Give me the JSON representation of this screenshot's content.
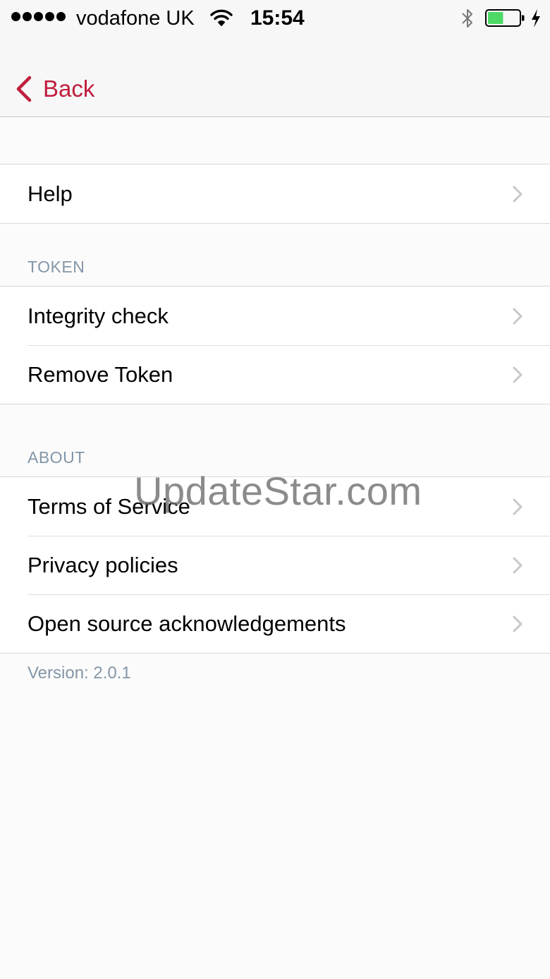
{
  "status_bar": {
    "carrier": "vodafone UK",
    "time": "15:54",
    "signal_icon": "signal-dots-icon",
    "wifi_icon": "wifi-icon",
    "bluetooth_icon": "bluetooth-icon",
    "battery_icon": "battery-charging-icon",
    "battery_level": 0.5,
    "battery_color": "#4cd964"
  },
  "nav": {
    "back_label": "Back",
    "accent_color": "#c01d3d"
  },
  "sections": {
    "general": {
      "items": [
        {
          "label": "Help"
        }
      ]
    },
    "token": {
      "header": "TOKEN",
      "items": [
        {
          "label": "Integrity check"
        },
        {
          "label": "Remove Token"
        }
      ]
    },
    "about": {
      "header": "ABOUT",
      "items": [
        {
          "label": "Terms of Service"
        },
        {
          "label": "Privacy policies"
        },
        {
          "label": "Open source acknowledgements"
        }
      ]
    }
  },
  "footer": {
    "version": "Version: 2.0.1"
  },
  "watermark": "UpdateStar.com"
}
